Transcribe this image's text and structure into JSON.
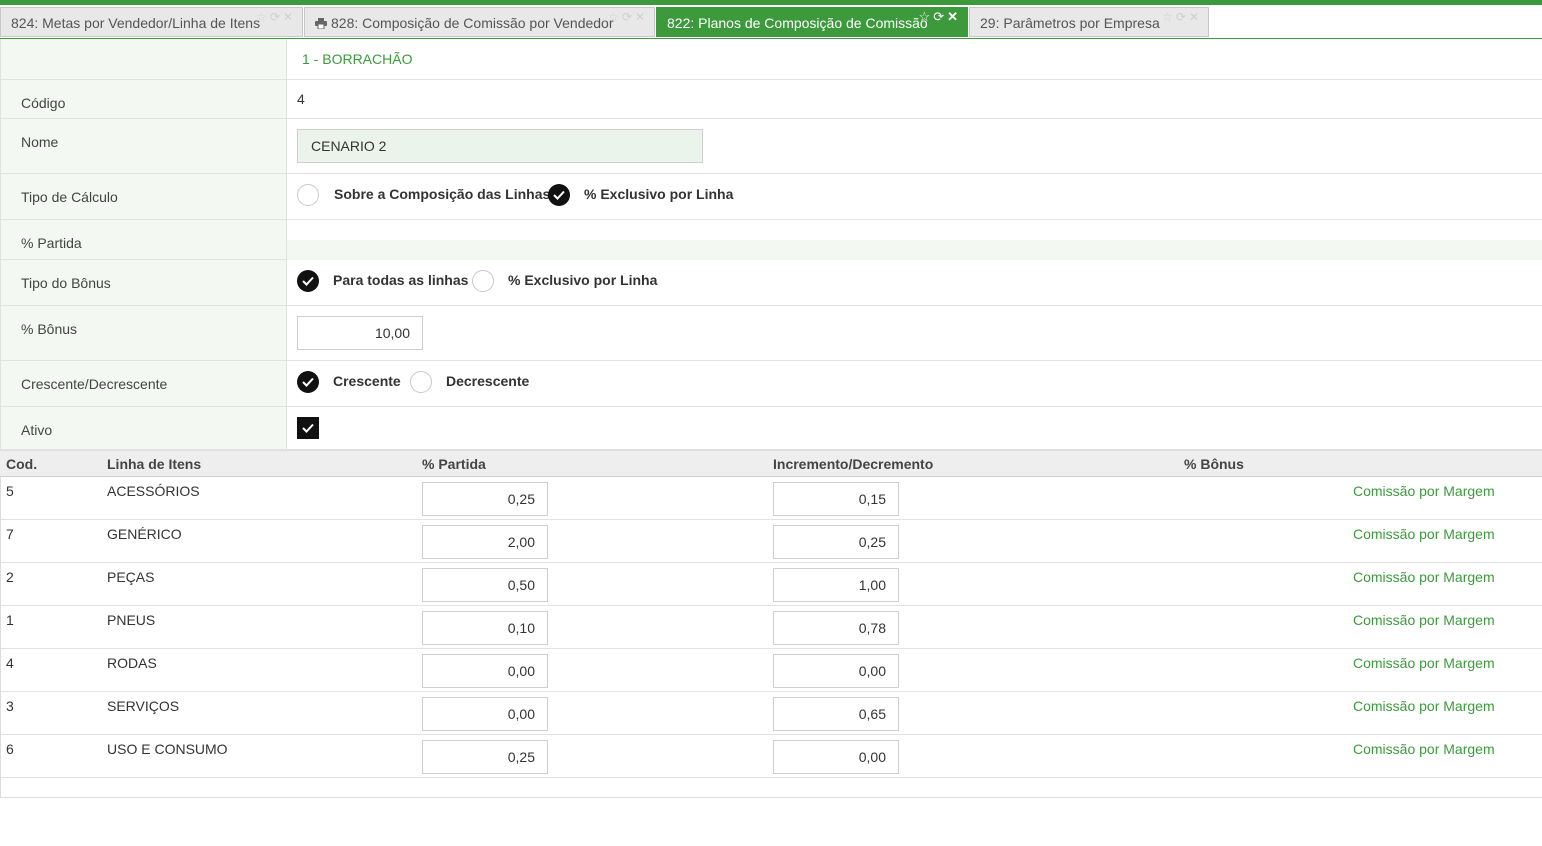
{
  "tabs": [
    {
      "label": "824: Metas por Vendedor/Linha de Itens",
      "active": false,
      "icon": ""
    },
    {
      "label": "828: Composição de Comissão por Vendedor",
      "active": false,
      "icon": "printer-icon"
    },
    {
      "label": "822: Planos de Composição de Comissão",
      "active": true,
      "icon": ""
    },
    {
      "label": "29: Parâmetros por Empresa",
      "active": false,
      "icon": ""
    }
  ],
  "form": {
    "header": "1 - BORRACHÃO",
    "codigo_label": "Código",
    "codigo_value": "4",
    "nome_label": "Nome",
    "nome_value": "CENARIO 2",
    "tipo_calculo_label": "Tipo de Cálculo",
    "tipo_calculo_options": [
      "Sobre a Composição das Linhas",
      "% Exclusivo por Linha"
    ],
    "tipo_calculo_selected": "% Exclusivo por Linha",
    "partida_label": "% Partida",
    "tipo_bonus_label": "Tipo do Bônus",
    "tipo_bonus_options": [
      "Para todas as linhas",
      "% Exclusivo por Linha"
    ],
    "tipo_bonus_selected": "Para todas as linhas",
    "bonus_label": "% Bônus",
    "bonus_value": "10,00",
    "ordem_label": "Crescente/Decrescente",
    "ordem_options": [
      "Crescente",
      "Decrescente"
    ],
    "ordem_selected": "Crescente",
    "ativo_label": "Ativo",
    "ativo_checked": true
  },
  "grid": {
    "columns": [
      "Cod.",
      "Linha de Itens",
      "% Partida",
      "Incremento/Decremento",
      "% Bônus"
    ],
    "link_label": "Comissão por Margem",
    "rows": [
      {
        "cod": "5",
        "linha": "ACESSÓRIOS",
        "partida": "0,25",
        "incremento": "0,15"
      },
      {
        "cod": "7",
        "linha": "GENÉRICO",
        "partida": "2,00",
        "incremento": "0,25"
      },
      {
        "cod": "2",
        "linha": "PEÇAS",
        "partida": "0,50",
        "incremento": "1,00"
      },
      {
        "cod": "1",
        "linha": "PNEUS",
        "partida": "0,10",
        "incremento": "0,78"
      },
      {
        "cod": "4",
        "linha": "RODAS",
        "partida": "0,00",
        "incremento": "0,00"
      },
      {
        "cod": "3",
        "linha": "SERVIÇOS",
        "partida": "0,00",
        "incremento": "0,65"
      },
      {
        "cod": "6",
        "linha": "USO E CONSUMO",
        "partida": "0,25",
        "incremento": "0,00"
      }
    ]
  },
  "colors": {
    "accent": "#3c9a3c",
    "label_bg": "#f3f8f3",
    "input_bg_highlight": "#eaf4ea"
  }
}
